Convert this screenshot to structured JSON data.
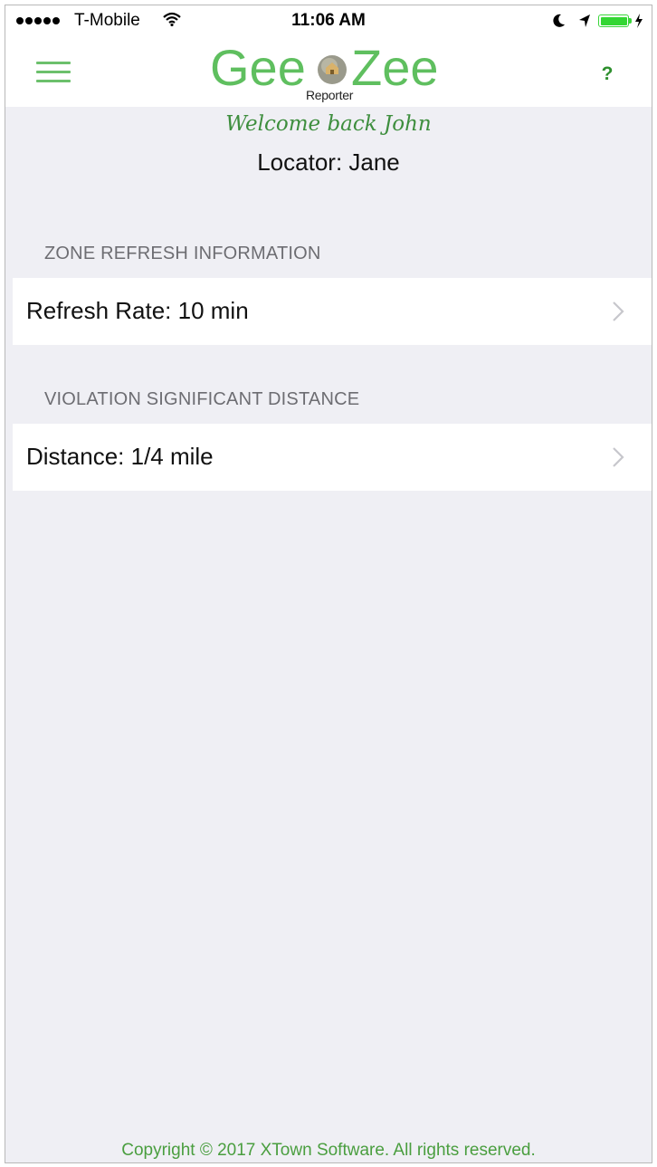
{
  "status_bar": {
    "carrier": "T-Mobile",
    "time": "11:06 AM",
    "battery_level": 1.0
  },
  "header": {
    "logo": {
      "left": "Gee",
      "right": "Zee",
      "sub": "Reporter"
    },
    "help_label": "?"
  },
  "welcome": {
    "greeting": "Welcome back John",
    "locator": "Locator: Jane"
  },
  "sections": [
    {
      "header": "ZONE REFRESH INFORMATION",
      "cell_label": "Refresh Rate: 10 min"
    },
    {
      "header": "VIOLATION SIGNIFICANT DISTANCE",
      "cell_label": "Distance: 1/4 mile"
    }
  ],
  "footer": {
    "copyright": "Copyright ©  2017 XTown Software. All rights reserved."
  },
  "colors": {
    "brand_green": "#5fbf5f",
    "footer_green": "#4a9e3f",
    "background": "#efeff4"
  }
}
